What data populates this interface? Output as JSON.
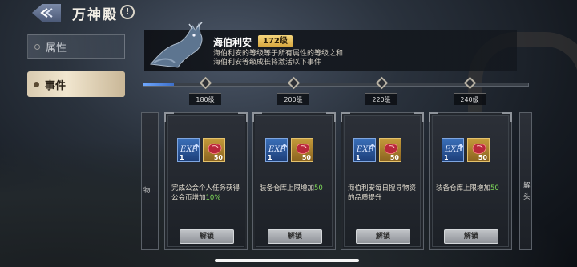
{
  "header": {
    "title": "万神殿",
    "info_glyph": "!"
  },
  "tabs": [
    {
      "label": "属性",
      "active": false
    },
    {
      "label": "事件",
      "active": true
    }
  ],
  "hero": {
    "name": "海伯利安",
    "level": "172级",
    "description_line1": "海伯利安的等级等于所有属性的等级之和",
    "description_line2": "海伯利安等级成长将激活以下事件"
  },
  "progress": {
    "fraction": 0.08
  },
  "milestones": [
    "180级",
    "200级",
    "220级",
    "240级"
  ],
  "cards": [
    {
      "exp_label": "EXP",
      "exp_count": "1",
      "gem_count": "50",
      "desc_plain": "完成公会个人任务获得公会币增加",
      "desc_highlight": "10%",
      "button": "解锁"
    },
    {
      "exp_label": "EXP",
      "exp_count": "1",
      "gem_count": "50",
      "desc_plain": "装备仓库上限增加",
      "desc_highlight": "50",
      "button": "解锁"
    },
    {
      "exp_label": "EXP",
      "exp_count": "1",
      "gem_count": "50",
      "desc_plain": "海伯利安每日搜寻物资的品质提升",
      "desc_highlight": "",
      "button": "解锁"
    },
    {
      "exp_label": "EXP",
      "exp_count": "1",
      "gem_count": "50",
      "desc_plain": "装备仓库上限增加",
      "desc_highlight": "50",
      "button": "解锁"
    }
  ],
  "edge_cards": {
    "left_fragment": "物",
    "right_fragment_line1": "解",
    "right_fragment_line2": "头"
  },
  "colors": {
    "accent_gold": "#f6d67d",
    "highlight_green": "#7fdc5a",
    "progress_blue": "#6fa8ff"
  }
}
